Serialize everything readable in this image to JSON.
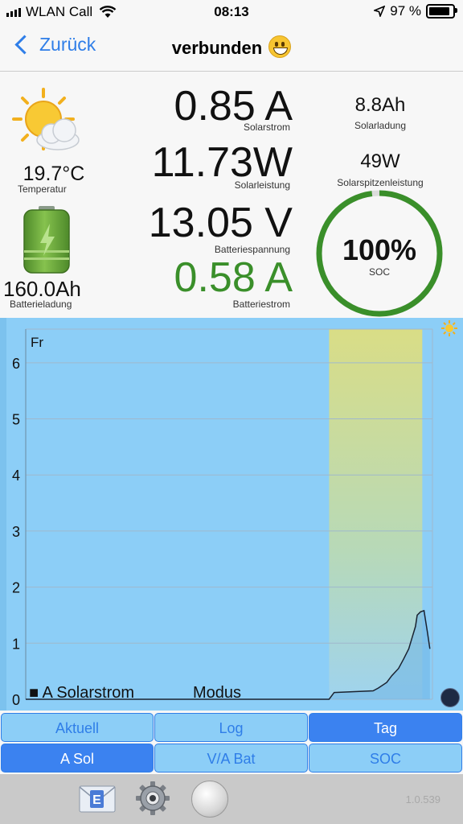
{
  "status": {
    "carrier": "WLAN Call",
    "time": "08:13",
    "battery": "97 %",
    "battery_level": 0.97
  },
  "nav": {
    "back_label": "Zurück",
    "title": "verbunden"
  },
  "metrics": {
    "solarstrom": {
      "value": "0.85 A",
      "label": "Solarstrom"
    },
    "solarleistung": {
      "value": "11.73W",
      "label": "Solarleistung"
    },
    "batteriespannung": {
      "value": "13.05 V",
      "label": "Batteriespannung"
    },
    "batteriestrom": {
      "value": "0.58 A",
      "label": "Batteriestrom",
      "color": "#3a8f2a"
    },
    "solarladung": {
      "value": "8.8Ah",
      "label": "Solarladung"
    },
    "solarspitzenleistung": {
      "value": "49W",
      "label": "Solarspitzenleistung"
    },
    "temperatur": {
      "value": "19.7°C",
      "label": "Temperatur"
    },
    "batterieladung": {
      "value": "160.0Ah",
      "label": "Batterieladung"
    },
    "soc": {
      "value": "100%",
      "label": "SOC",
      "fraction": 0.98
    }
  },
  "chart_data": {
    "type": "line",
    "corner_label": "Fr",
    "ylim": [
      0,
      6.6
    ],
    "yticks": [
      "0",
      "1",
      "2",
      "3",
      "4",
      "5",
      "6"
    ],
    "xlim": [
      0,
      24
    ],
    "legend": [
      "A Solarstrom",
      "Modus"
    ],
    "highlight_band": [
      17.9,
      23.4
    ],
    "series": [
      {
        "name": "A Solarstrom",
        "x": [
          0,
          17.9,
          18.2,
          20.5,
          20.8,
          21.3,
          21.6,
          22.0,
          22.3,
          22.6,
          22.8,
          23.0,
          23.1,
          23.3,
          23.5,
          23.7,
          23.85
        ],
        "y": [
          0,
          0,
          0.12,
          0.15,
          0.2,
          0.3,
          0.42,
          0.55,
          0.72,
          0.9,
          1.1,
          1.3,
          1.5,
          1.56,
          1.58,
          1.2,
          0.9
        ]
      }
    ]
  },
  "tabs_row1": [
    "Aktuell",
    "Log",
    "Tag"
  ],
  "tabs_row2": [
    "A Sol",
    "V/A Bat",
    "SOC"
  ],
  "version": "1.0.539",
  "colors": {
    "accent": "#2f7ee8",
    "chart_bg": "#8ccef7",
    "soc_ring": "#3a8f2a"
  }
}
